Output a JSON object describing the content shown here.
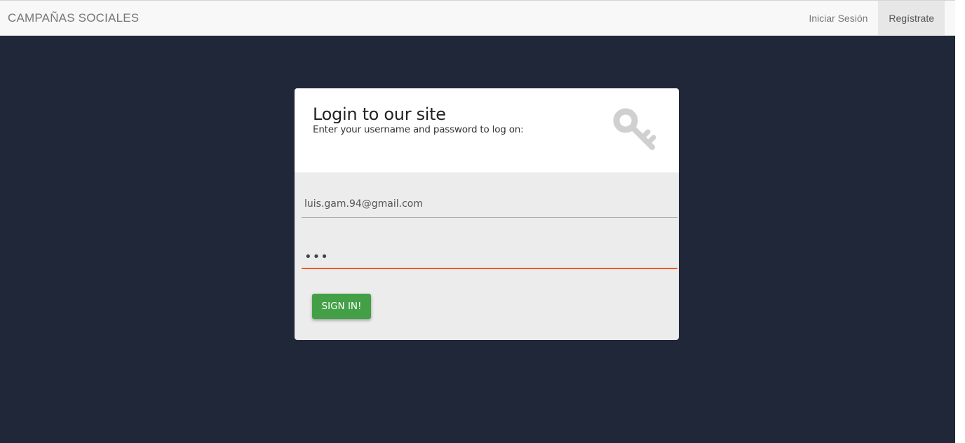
{
  "navbar": {
    "brand": "CAMPAÑAS SOCIALES",
    "links": [
      {
        "label": "Iniciar Sesión"
      },
      {
        "label": "Regístrate"
      }
    ]
  },
  "login": {
    "title": "Login to our site",
    "subtitle": "Enter your username and password to log on:",
    "icon": "key-icon",
    "email_value": "luis.gam.94@gmail.com",
    "password_value": "•••",
    "submit_label": "SIGN IN!"
  },
  "colors": {
    "page_background": "#1f2738",
    "navbar_background": "#f8f8f8",
    "form_background": "#ececec",
    "focus_underline": "#ee5a2f",
    "button": "#43a047",
    "icon": "#d0d0d0"
  }
}
